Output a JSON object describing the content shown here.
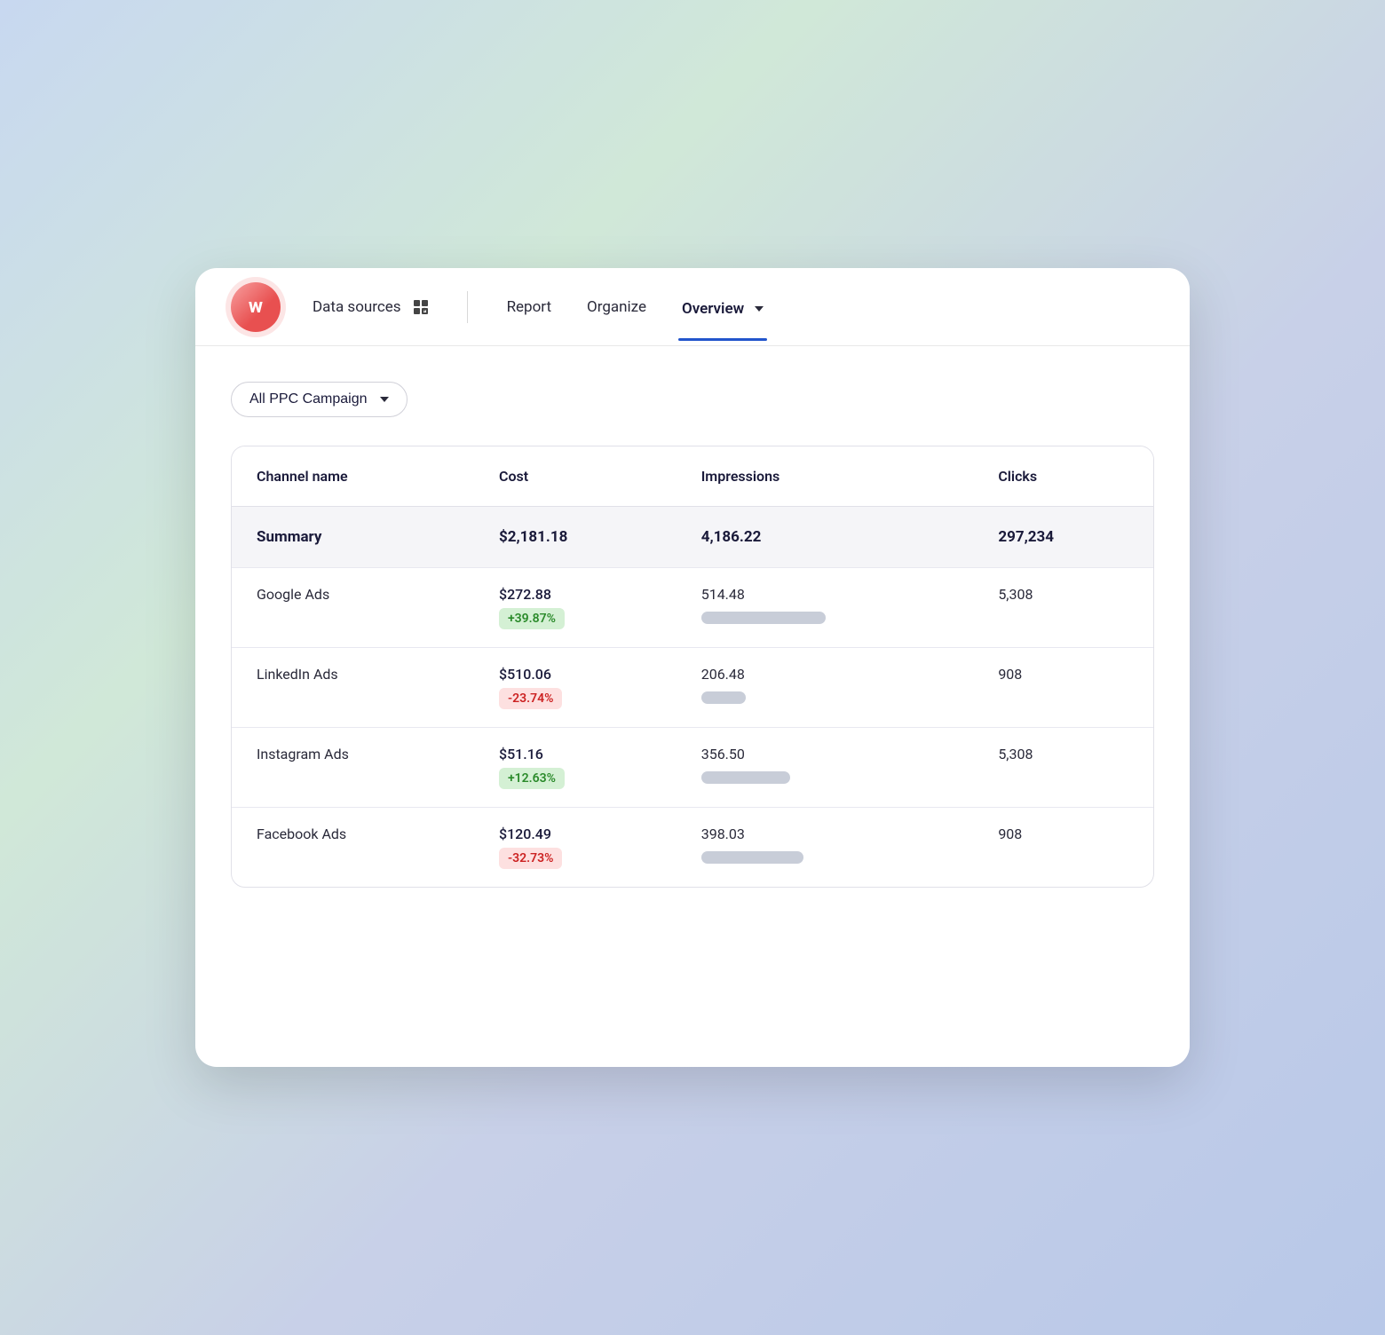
{
  "nav": {
    "logo_letter": "w",
    "data_sources_label": "Data sources",
    "report_label": "Report",
    "organize_label": "Organize",
    "overview_label": "Overview"
  },
  "campaign_selector": {
    "label": "All PPC Campaign"
  },
  "table": {
    "headers": {
      "channel": "Channel name",
      "cost": "Cost",
      "impressions": "Impressions",
      "clicks": "Clicks"
    },
    "summary": {
      "label": "Summary",
      "cost": "$2,181.18",
      "impressions": "4,186.22",
      "clicks": "297,234"
    },
    "rows": [
      {
        "channel": "Google Ads",
        "cost": "$272.88",
        "badge": "+39.87%",
        "badge_type": "green",
        "impressions": "514.48",
        "bar_class": "bar-large",
        "clicks": "5,308"
      },
      {
        "channel": "LinkedIn Ads",
        "cost": "$510.06",
        "badge": "-23.74%",
        "badge_type": "red",
        "impressions": "206.48",
        "bar_class": "bar-small",
        "clicks": "908"
      },
      {
        "channel": "Instagram Ads",
        "cost": "$51.16",
        "badge": "+12.63%",
        "badge_type": "green",
        "impressions": "356.50",
        "bar_class": "bar-medium",
        "clicks": "5,308"
      },
      {
        "channel": "Facebook Ads",
        "cost": "$120.49",
        "badge": "-32.73%",
        "badge_type": "red",
        "impressions": "398.03",
        "bar_class": "bar-medium2",
        "clicks": "908"
      }
    ]
  },
  "colors": {
    "active_nav_underline": "#2255cc",
    "badge_green_bg": "#d4f0d4",
    "badge_green_text": "#2a8a2a",
    "badge_red_bg": "#fde0e0",
    "badge_red_text": "#cc2222"
  }
}
